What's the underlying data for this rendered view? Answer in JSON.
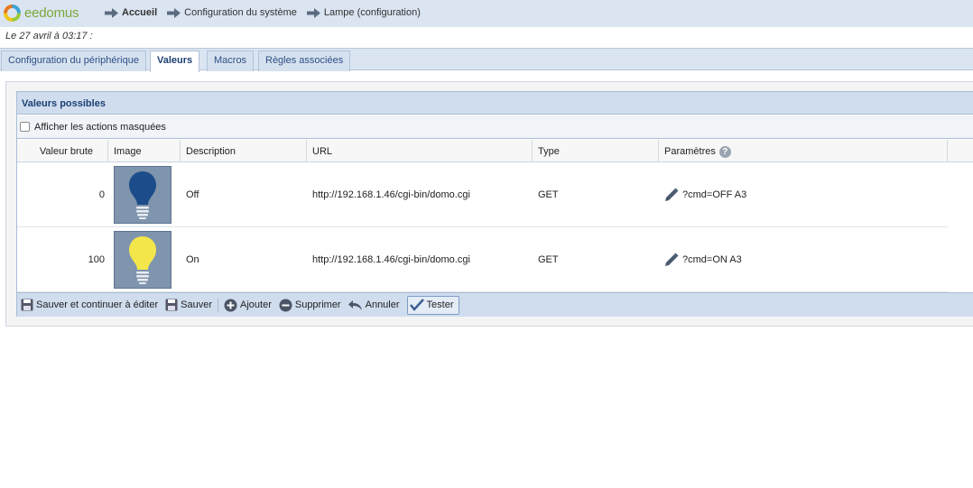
{
  "brand": {
    "name": "eedomus"
  },
  "breadcrumb": [
    {
      "label": "Accueil"
    },
    {
      "label": "Configuration du système"
    },
    {
      "label": "Lampe (configuration)"
    }
  ],
  "date_line": "Le 27 avril à 03:17 :",
  "tabs": [
    {
      "label": "Configuration du périphérique"
    },
    {
      "label": "Valeurs"
    },
    {
      "label": "Macros"
    },
    {
      "label": "Règles associées"
    }
  ],
  "active_tab": "Valeurs",
  "panel": {
    "title": "Valeurs possibles",
    "show_hidden_label": "Afficher les actions masquées",
    "show_hidden_checked": false
  },
  "table": {
    "columns": [
      "Valeur brute",
      "Image",
      "Description",
      "URL",
      "Type",
      "Paramètres"
    ],
    "rows": [
      {
        "raw": "0",
        "image": "bulb-off-icon",
        "description": "Off",
        "url": "http://192.168.1.46/cgi-bin/domo.cgi",
        "type": "GET",
        "params": "?cmd=OFF A3"
      },
      {
        "raw": "100",
        "image": "bulb-on-icon",
        "description": "On",
        "url": "http://192.168.1.46/cgi-bin/domo.cgi",
        "type": "GET",
        "params": "?cmd=ON A3"
      }
    ]
  },
  "toolbar": {
    "save_continue": "Sauver et continuer à éditer",
    "save": "Sauver",
    "add": "Ajouter",
    "delete": "Supprimer",
    "cancel": "Annuler",
    "test": "Tester"
  },
  "colors": {
    "bar_bg": "#dbe4f1",
    "panel_head": "#cfddee",
    "accent_text": "#1d3f74",
    "bulb_off": "#1c4d8a",
    "bulb_on": "#f3e64b",
    "image_bg": "#7f94ad"
  }
}
